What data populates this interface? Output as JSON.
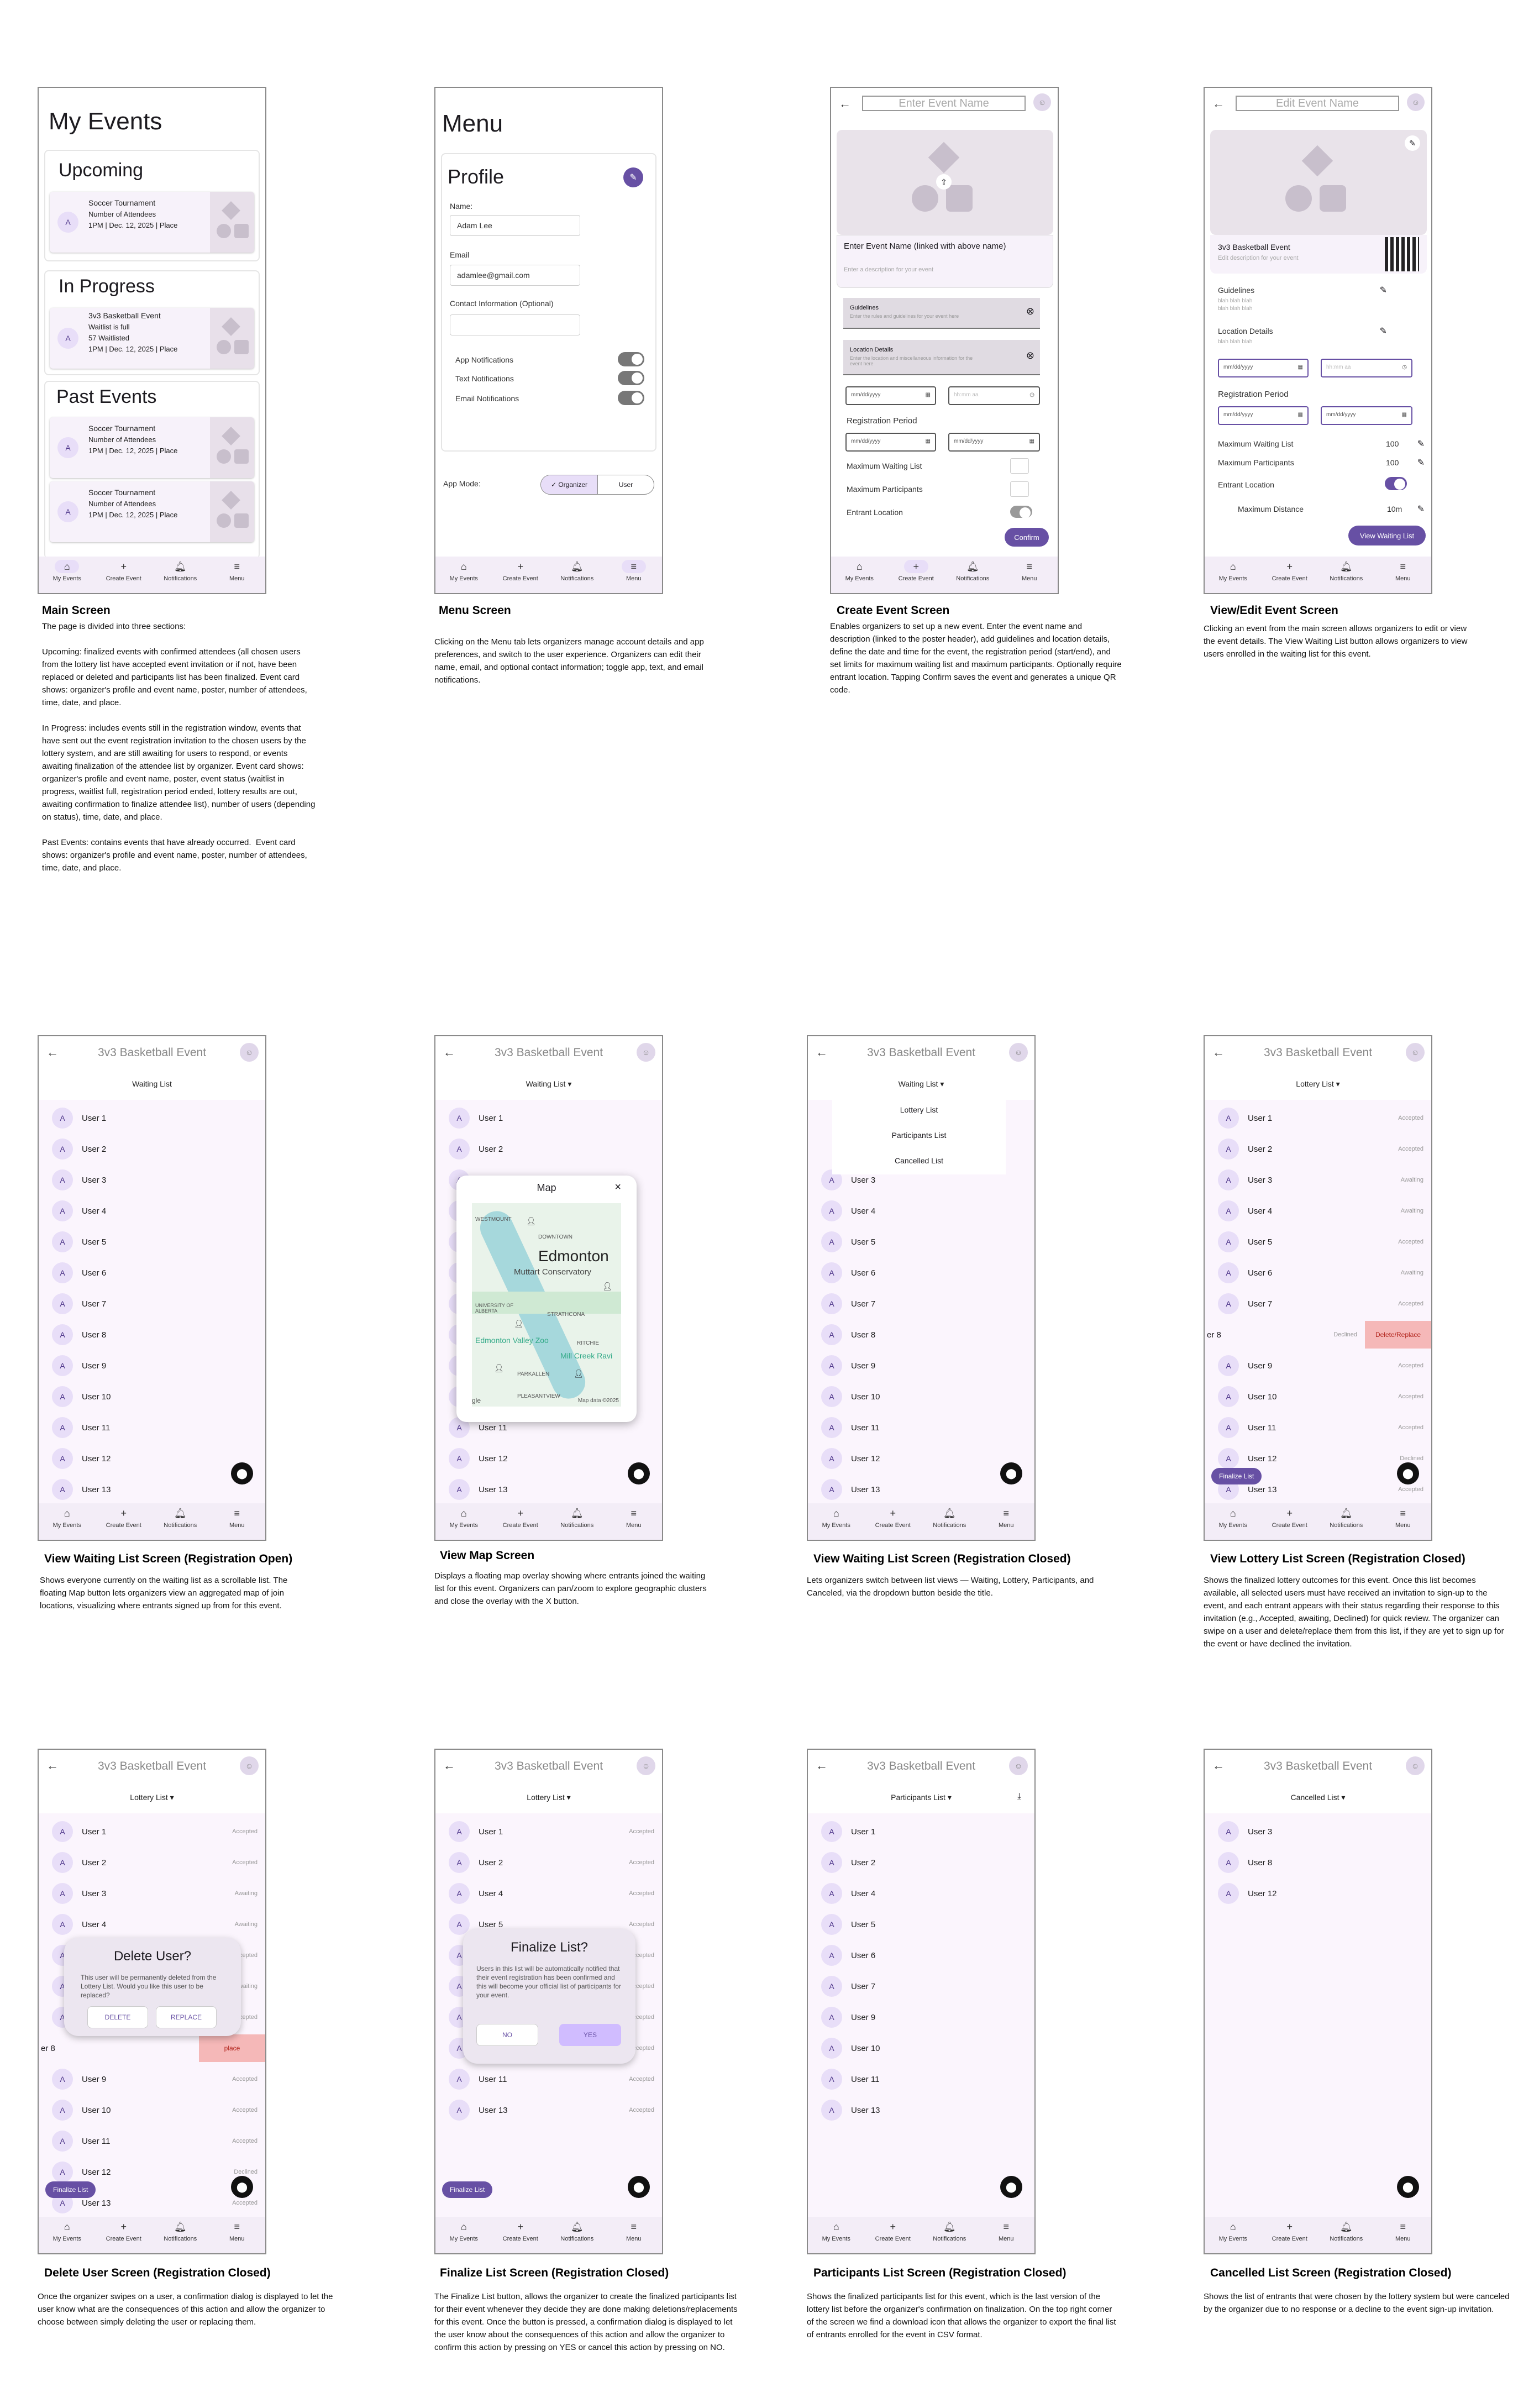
{
  "nav": {
    "my_events": "My Events",
    "create_event": "Create Event",
    "notifications": "Notifications",
    "menu": "Menu"
  },
  "event_title": "3v3 Basketball Event",
  "avatar_letter": "A",
  "main": {
    "title": "My Events",
    "upcoming": "Upcoming",
    "in_progress": "In Progress",
    "past": "Past Events",
    "card1": {
      "name": "Soccer Tournament",
      "line2": "Number of Attendees",
      "line3": "1PM  |  Dec. 12, 2025 | Place"
    },
    "card2": {
      "name": "3v3 Basketball Event",
      "line2": "Waitlist is full",
      "line3": "57 Waitlisted",
      "line4": "1PM  |  Dec. 12, 2025 | Place"
    },
    "card3": {
      "name": "Soccer Tournament",
      "line2": "Number of Attendees",
      "line3": "1PM  |  Dec. 12, 2025 | Place"
    },
    "card4": {
      "name": "Soccer Tournament",
      "line2": "Number of Attendees",
      "line3": "1PM  |  Dec. 12, 2025 | Place"
    }
  },
  "menu": {
    "title": "Menu",
    "profile": "Profile",
    "name_label": "Name:",
    "name_value": "Adam Lee",
    "email_label": "Email",
    "email_value": "adamlee@gmail.com",
    "contact_label": "Contact Information (Optional)",
    "app_notif": "App Notifications",
    "text_notif": "Text Notifications",
    "email_notif": "Email Notifications",
    "app_mode": "App Mode:",
    "organizer": "✓  Organizer",
    "user": "User"
  },
  "create": {
    "placeholder": "Enter Event Name",
    "name_line": "Enter Event Name (linked with above name)",
    "desc": "Enter a description for your event",
    "guidelines": "Guidelines",
    "guidelines_sub": "Enter the rules and guidelines for your event here",
    "location": "Location Details",
    "location_sub": "Enter the location and miscellaneous information for the event here",
    "date_ph": "mm/dd/yyyy",
    "time_ph": "hh:mm aa",
    "start": "Start",
    "time": "Time",
    "end": "End",
    "reg_period": "Registration  Period",
    "max_wait": "Maximum Waiting List",
    "max_part": "Maximum Participants",
    "entrant_loc": "Entrant Location",
    "confirm": "Confirm"
  },
  "edit": {
    "placeholder": "Edit Event Name",
    "desc": "Edit description for your event",
    "guidelines": "Guidelines",
    "blah": "blah blah blah",
    "location": "Location Details",
    "max_wait": "Maximum Waiting List",
    "max_wait_v": "100",
    "max_part": "Maximum Participants",
    "max_part_v": "100",
    "entrant_loc": "Entrant Location",
    "max_dist": "Maximum Distance",
    "max_dist_v": "10m",
    "view_wait": "View Waiting List",
    "reg_period": "Registration  Period"
  },
  "lists": {
    "waiting": "Waiting List",
    "lottery": "Lottery List",
    "participants": "Participants List",
    "cancelled": "Cancelled List"
  },
  "users": [
    "User 1",
    "User 2",
    "User 3",
    "User 4",
    "User 5",
    "User 6",
    "User 7",
    "User 8",
    "User 9",
    "User 10",
    "User 11",
    "User 12",
    "User 13"
  ],
  "lottery_status": [
    "Accepted",
    "Accepted",
    "Awaiting",
    "Awaiting",
    "Accepted",
    "Awaiting",
    "Accepted",
    "Declined",
    "Accepted",
    "Accepted",
    "Accepted",
    "Declined",
    "Accepted"
  ],
  "map": {
    "title": "Map",
    "city": "Edmonton",
    "westmount": "WESTMOUNT",
    "downtown": "DOWNTOWN",
    "muttart": "Muttart Conservatory",
    "ualberta": "UNIVERSITY OF ALBERTA",
    "strathcona": "STRATHCONA",
    "valley": "Edmonton Valley Zoo",
    "ritchie": "RITCHIE",
    "mill": "Mill Creek Ravi",
    "parkallen": "PARKALLEN",
    "pleasant": "PLEASANTVIEW",
    "data": "Map data ©2025",
    "gle": "gle"
  },
  "swipe": {
    "user": "er 8",
    "declined": "Declined",
    "delete_replace": "Delete/Replace"
  },
  "finalize_btn": "Finalize List",
  "delete_dlg": {
    "title": "Delete User?",
    "body": "This user will be permanently deleted from the Lottery List. Would you like this user to be replaced?",
    "delete": "DELETE",
    "replace": "REPLACE",
    "place": "place"
  },
  "finalize_dlg": {
    "title": "Finalize List?",
    "body": "Users in this list will be automatically notified that their event registration has been confirmed and this will become your official list of participants for your event.",
    "no": "NO",
    "yes": "YES"
  },
  "part_users": [
    "User 1",
    "User 2",
    "User 4",
    "User 5",
    "User 6",
    "User 7",
    "User 9",
    "User 10",
    "User 11",
    "User 13"
  ],
  "cancel_users": [
    "User 3",
    "User 8",
    "User 12"
  ],
  "final_users": [
    "User 1",
    "User 2",
    "User 4",
    "User 5",
    "User 6",
    "User 7",
    "User 9",
    "User 10",
    "User 11",
    "User 13"
  ],
  "captions": {
    "main_t": "Main Screen",
    "main_d": "The page is divided into three sections:\n\nUpcoming: finalized events with confirmed attendees (all chosen users from the lottery list have accepted event invitation or if not, have been replaced or deleted and participants list has been finalized. Event card shows: organizer's profile and event name, poster, number of attendees, time, date, and place.\n\nIn Progress: includes events still in the registration window, events that have sent out the event registration invitation to the chosen users by the lottery system, and are still awaiting for users to respond, or events awaiting finalization of the attendee list by organizer. Event card shows: organizer's profile and event name, poster, event status (waitlist in progress, waitlist full, registration period ended, lottery results are out, awaiting confirmation to finalize attendee list), number of users (depending on status), time, date, and place.\n\nPast Events: contains events that have already occurred.  Event card shows: organizer's profile and event name, poster, number of attendees, time, date, and place.",
    "menu_t": "Menu Screen",
    "menu_d": "Clicking on the Menu tab lets organizers manage account details and app preferences, and switch to the user experience. Organizers can edit their name, email, and optional contact information; toggle app, text, and email notifications.",
    "create_t": "Create Event Screen",
    "create_d": "Enables organizers to set up a new event. Enter the event name and description (linked to the poster header), add guidelines and location details, define the date and time for the event, the registration period (start/end), and set limits for maximum waiting list and maximum participants. Optionally require entrant location. Tapping Confirm saves the event and generates a unique QR code.",
    "edit_t": "View/Edit Event Screen",
    "edit_d": "Clicking an event from the main screen allows organizers to edit or view the event details. The View Waiting List button allows organizers to view users enrolled in the waiting list for this event.",
    "wait_t": "View Waiting List Screen (Registration Open)",
    "wait_d": "Shows everyone currently on the waiting list as a scrollable list. The floating Map button lets organizers view an aggregated map of join locations, visualizing where entrants signed up from for this event.",
    "map_t": "View Map Screen",
    "map_d": "Displays a floating map overlay showing where entrants joined the waiting list for this event. Organizers can pan/zoom to explore geographic clusters and close the overlay with the X button.",
    "wait2_t": "View Waiting List Screen (Registration Closed)",
    "wait2_d": "Lets organizers switch between list views — Waiting, Lottery, Participants, and Canceled, via the dropdown button beside the title.",
    "lot_t": "View Lottery List Screen (Registration Closed)",
    "lot_d": "Shows the finalized lottery outcomes for this event. Once this list becomes available, all selected users must have received an invitation to sign-up to the event, and each entrant appears with their status regarding their response to this invitation (e.g., Accepted, awaiting, Declined) for quick review. The organizer can swipe on a user and delete/replace them from this list, if they are yet to sign up for the event or have declined the invitation.",
    "del_t": "Delete User Screen (Registration Closed)",
    "del_d": "Once the organizer swipes on a user, a confirmation dialog is displayed to let the user know what are the consequences of this action and allow the organizer to choose between simply deleting the user or replacing them.",
    "fin_t": "Finalize List Screen (Registration Closed)",
    "fin_d": "The Finalize List button, allows the organizer to create the finalized participants list for their event whenever they decide they are done making deletions/replacements for this event. Once the button is pressed, a confirmation dialog is displayed to let the user know about the consequences of this action and allow the organizer to confirm this action by pressing on YES or cancel this action by pressing on NO.",
    "part_t": "Participants List Screen (Registration Closed)",
    "part_d": "Shows the finalized participants list for this event, which is the last version of the lottery list before the organizer's confirmation on finalization. On the top right corner of the screen we find a download icon that allows the organizer to export the final list of entrants enrolled for the event in CSV format.",
    "canc_t": "Cancelled List Screen (Registration Closed)",
    "canc_d": "Shows the list of entrants that were chosen by the lottery system but were canceled by the organizer due to no response or a decline to the event sign-up invitation."
  },
  "colors": {
    "accent": "#6750a4",
    "bg_list": "#fbf5fd",
    "chip": "#e8def8"
  }
}
